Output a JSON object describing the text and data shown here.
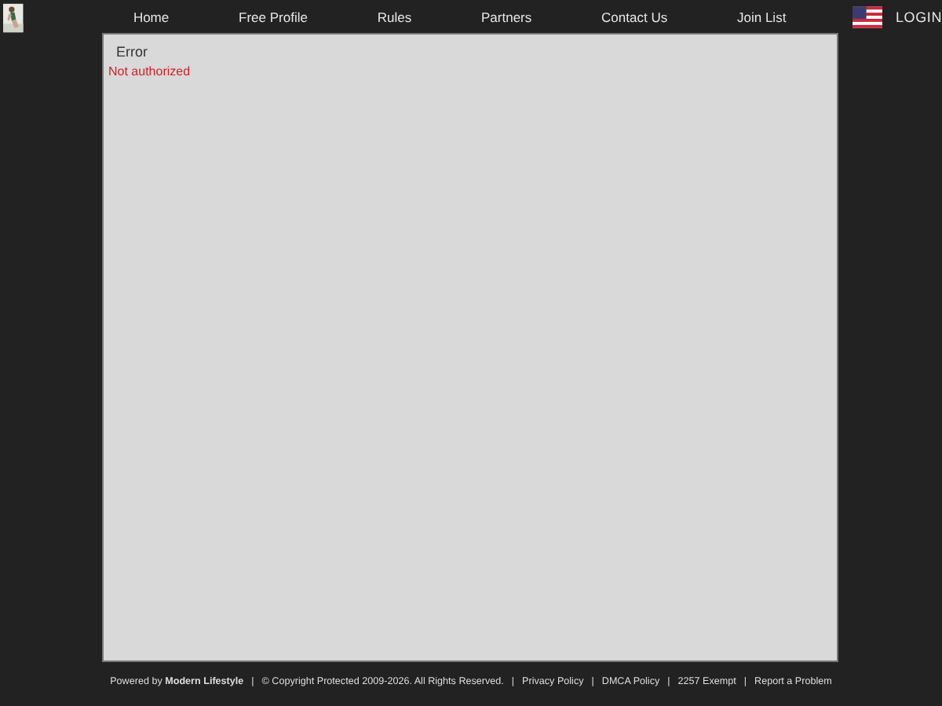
{
  "nav": {
    "items": [
      "Home",
      "Free Profile",
      "Rules",
      "Partners",
      "Contact Us",
      "Join List"
    ],
    "login": "LOGIN"
  },
  "panel": {
    "title": "Error",
    "message": "Not authorized"
  },
  "footer": [
    {
      "kind": "text",
      "text": "Powered by **Modern Lifestyle**"
    },
    {
      "kind": "separator",
      "text": "|"
    },
    {
      "kind": "text",
      "text": "© Copyright Protected 2009-2026. All Rights Reserved."
    },
    {
      "kind": "separator",
      "text": "|"
    },
    {
      "kind": "link",
      "text": "Privacy Policy"
    },
    {
      "kind": "separator",
      "text": "|"
    },
    {
      "kind": "link",
      "text": "DMCA Policy"
    },
    {
      "kind": "separator",
      "text": "|"
    },
    {
      "kind": "link",
      "text": "2257 Exempt"
    },
    {
      "kind": "separator",
      "text": "|"
    },
    {
      "kind": "link",
      "text": "Report a Problem"
    }
  ]
}
